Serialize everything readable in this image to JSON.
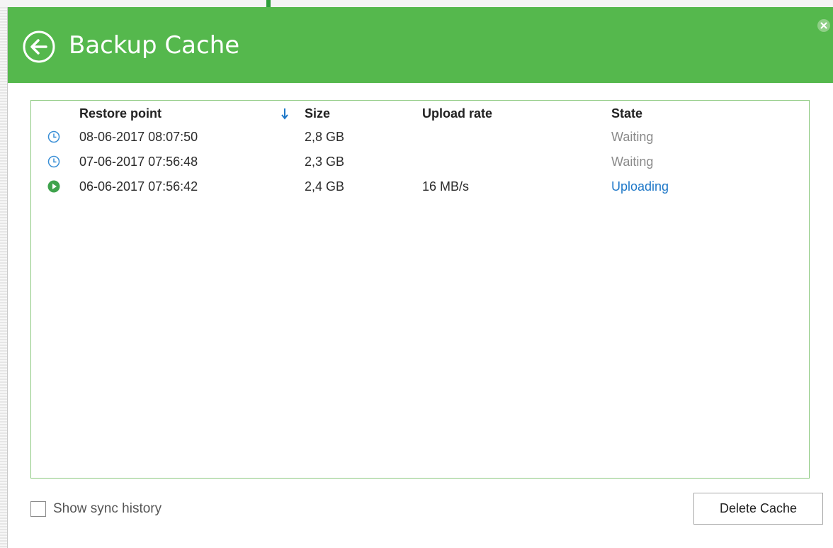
{
  "dialog": {
    "title": "Backup Cache",
    "header_color": "#55b84d"
  },
  "table": {
    "columns": {
      "restore_point": "Restore point",
      "size": "Size",
      "upload_rate": "Upload rate",
      "state": "State"
    },
    "sort": {
      "column": "Size",
      "direction": "descending",
      "icon": "sort-down-arrow-icon"
    },
    "rows": [
      {
        "restore_point": "08-06-2017 08:07:50",
        "size": "2,8 GB",
        "upload_rate": "",
        "state": "Waiting",
        "icon": "clock-icon"
      },
      {
        "restore_point": "07-06-2017 07:56:48",
        "size": "2,3 GB",
        "upload_rate": "",
        "state": "Waiting",
        "icon": "clock-icon"
      },
      {
        "restore_point": "06-06-2017 07:56:42",
        "size": "2,4 GB",
        "upload_rate": "16 MB/s",
        "state": "Uploading",
        "icon": "play-icon"
      }
    ]
  },
  "footer": {
    "show_sync_history_label": "Show sync history",
    "show_sync_history_checked": false,
    "delete_button_label": "Delete Cache"
  },
  "colors": {
    "accent_green": "#55b84d",
    "uploading_blue": "#1f78c8",
    "waiting_gray": "#8a8a8a",
    "clock_blue": "#3a8fd6",
    "play_green": "#3fa34d"
  }
}
